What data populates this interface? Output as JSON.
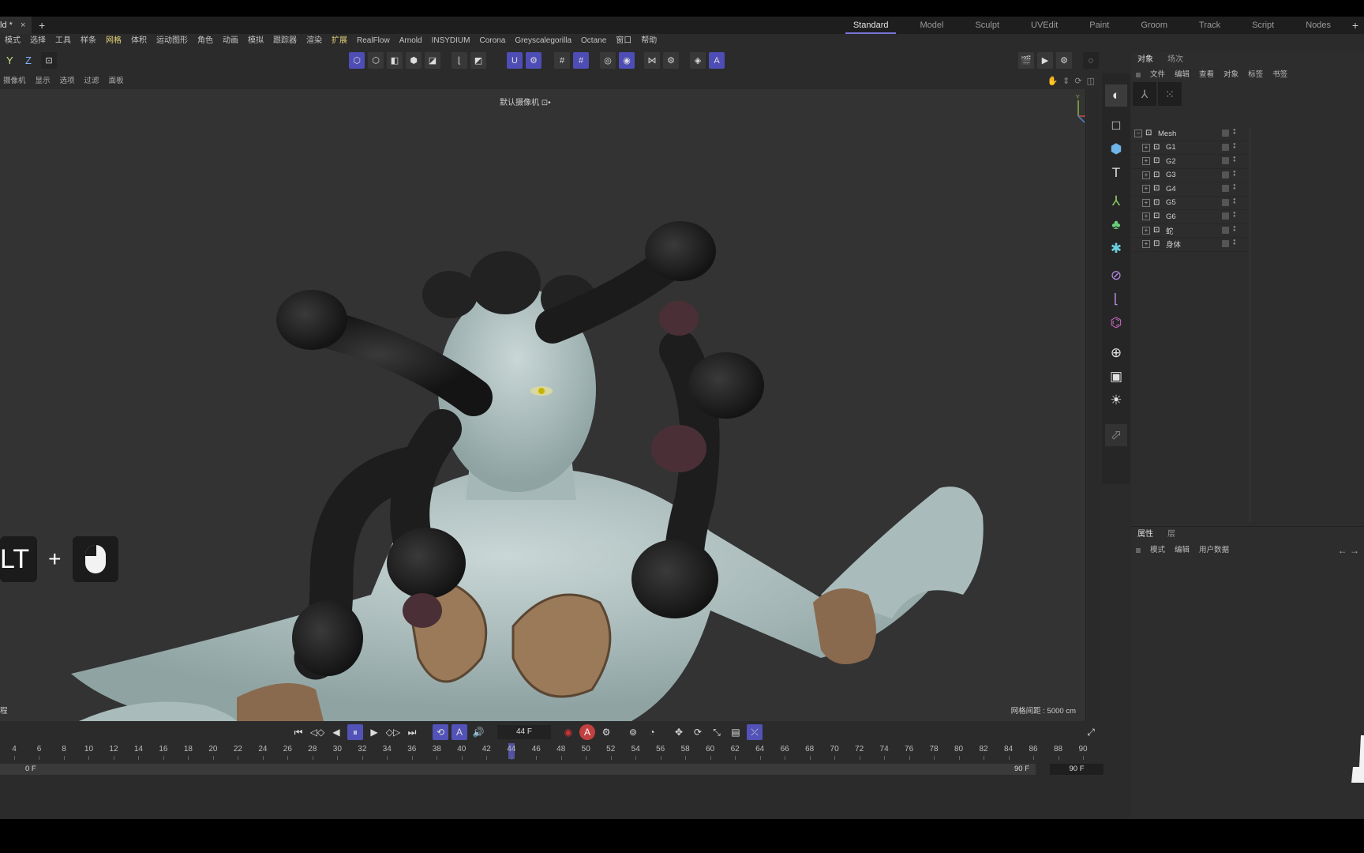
{
  "document": {
    "tab_title": "ld *",
    "close": "×",
    "new_tab": "+"
  },
  "layouts": {
    "items": [
      "Standard",
      "Model",
      "Sculpt",
      "UVEdit",
      "Paint",
      "Groom",
      "Track",
      "Script",
      "Nodes"
    ],
    "active": "Standard",
    "add": "+"
  },
  "menu": [
    "模式",
    "选择",
    "工具",
    "样条",
    "网格",
    "体积",
    "运动图形",
    "角色",
    "动画",
    "模拟",
    "跟踪器",
    "渲染",
    "扩展",
    "RealFlow",
    "Arnold",
    "INSYDIUM",
    "Corona",
    "Greyscalegorilla",
    "Octane",
    "窗口",
    "帮助"
  ],
  "menu_highlight": [
    "网格",
    "扩展"
  ],
  "axes": {
    "y": "Y",
    "z": "Z"
  },
  "viewport_menu": [
    "摄像机",
    "显示",
    "选项",
    "过滤",
    "面板"
  ],
  "viewport": {
    "camera_label": "默认摄像机 ⊡•",
    "grid_spacing": "网格间距 : 5000 cm",
    "left_label": "程",
    "gizmo": {
      "y": "Y",
      "x": "X",
      "z": "Z"
    }
  },
  "hint": {
    "key": "LT",
    "plus": "+"
  },
  "object_manager": {
    "tabs": [
      "对象",
      "场次"
    ],
    "active_tab": "对象",
    "menu": [
      "文件",
      "编辑",
      "查看",
      "对象",
      "标签",
      "书签"
    ],
    "tree": [
      {
        "name": "Mesh",
        "level": 0
      },
      {
        "name": "G1",
        "level": 1
      },
      {
        "name": "G2",
        "level": 1
      },
      {
        "name": "G3",
        "level": 1
      },
      {
        "name": "G4",
        "level": 1
      },
      {
        "name": "G5",
        "level": 1
      },
      {
        "name": "G6",
        "level": 1
      },
      {
        "name": "蛇",
        "level": 1
      },
      {
        "name": "身体",
        "level": 1
      }
    ]
  },
  "attributes": {
    "tabs": [
      "属性",
      "层"
    ],
    "active_tab": "属性",
    "menu": [
      "模式",
      "编辑",
      "用户数据"
    ],
    "arrows": "← →"
  },
  "transport": {
    "current_frame": "44 F"
  },
  "timeline": {
    "ticks": [
      4,
      6,
      8,
      10,
      12,
      14,
      16,
      18,
      20,
      22,
      24,
      26,
      28,
      30,
      32,
      34,
      36,
      38,
      40,
      42,
      44,
      46,
      48,
      50,
      52,
      54,
      56,
      58,
      60,
      62,
      64,
      66,
      68,
      70,
      72,
      74,
      76,
      78,
      80,
      82,
      84,
      86,
      88,
      90
    ],
    "current": 44,
    "start_label": "0 F",
    "end_label": "90 F",
    "max_label": "90 F"
  },
  "colors": {
    "accent": "#5252b8",
    "highlight_menu": "#e8d57a",
    "layout_underline": "#7a74d8"
  }
}
